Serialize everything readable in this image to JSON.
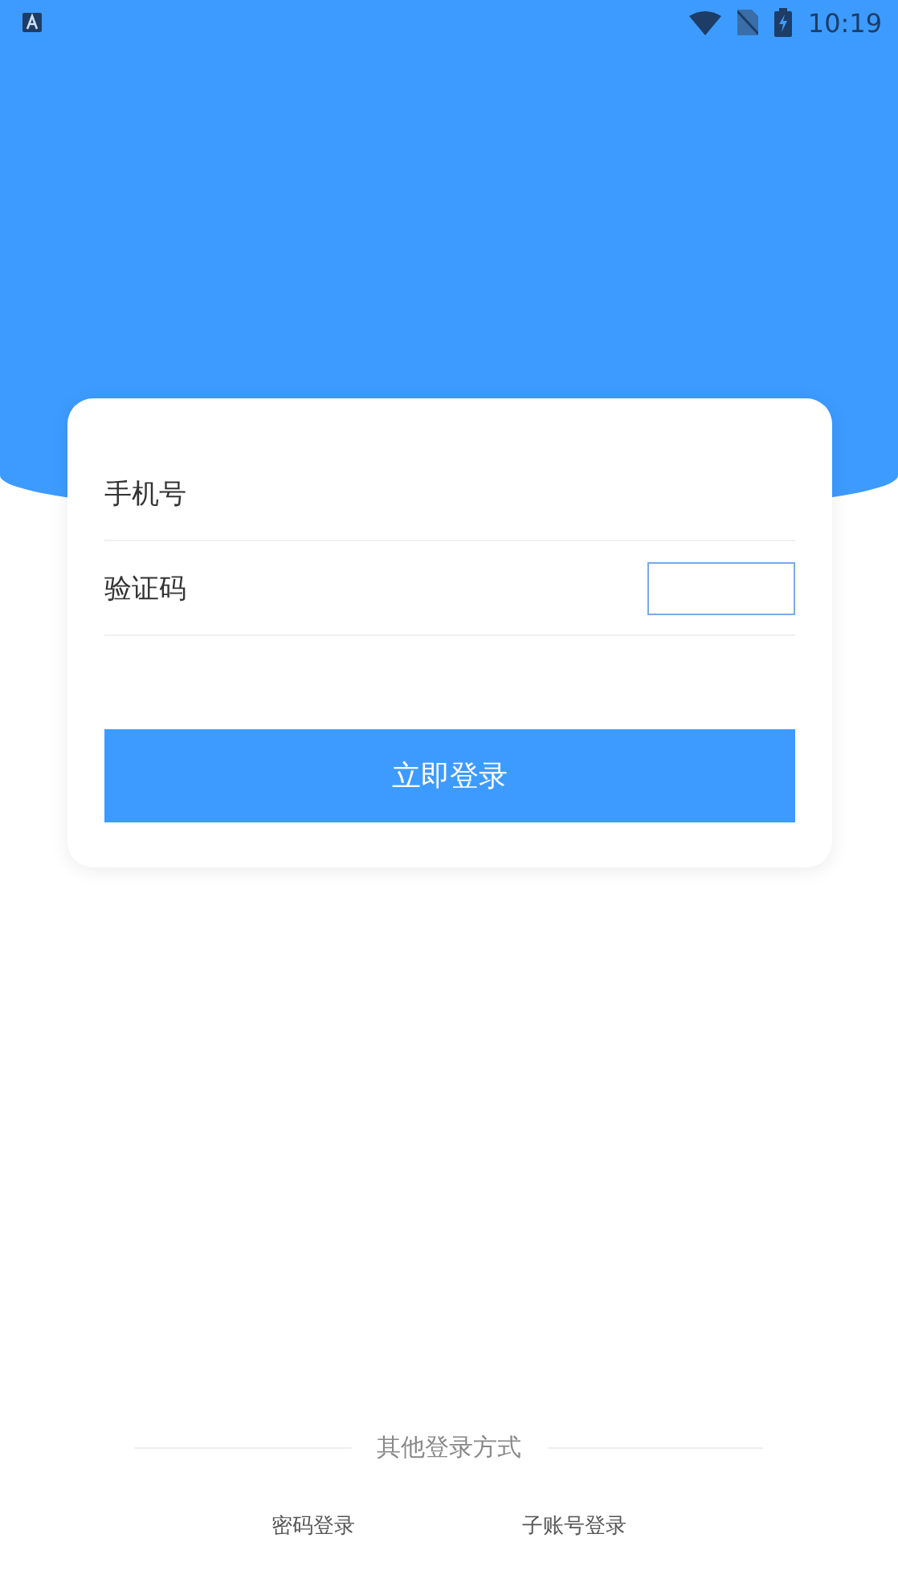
{
  "status_bar": {
    "time": "10:19"
  },
  "form": {
    "fields": [
      {
        "kind": "phone",
        "label": "手机号"
      },
      {
        "kind": "code",
        "label": "验证码"
      }
    ],
    "submit": "立即登录"
  },
  "other_login": {
    "title": "其他登录方式",
    "options": [
      "密码登录",
      "子账号登录"
    ]
  }
}
